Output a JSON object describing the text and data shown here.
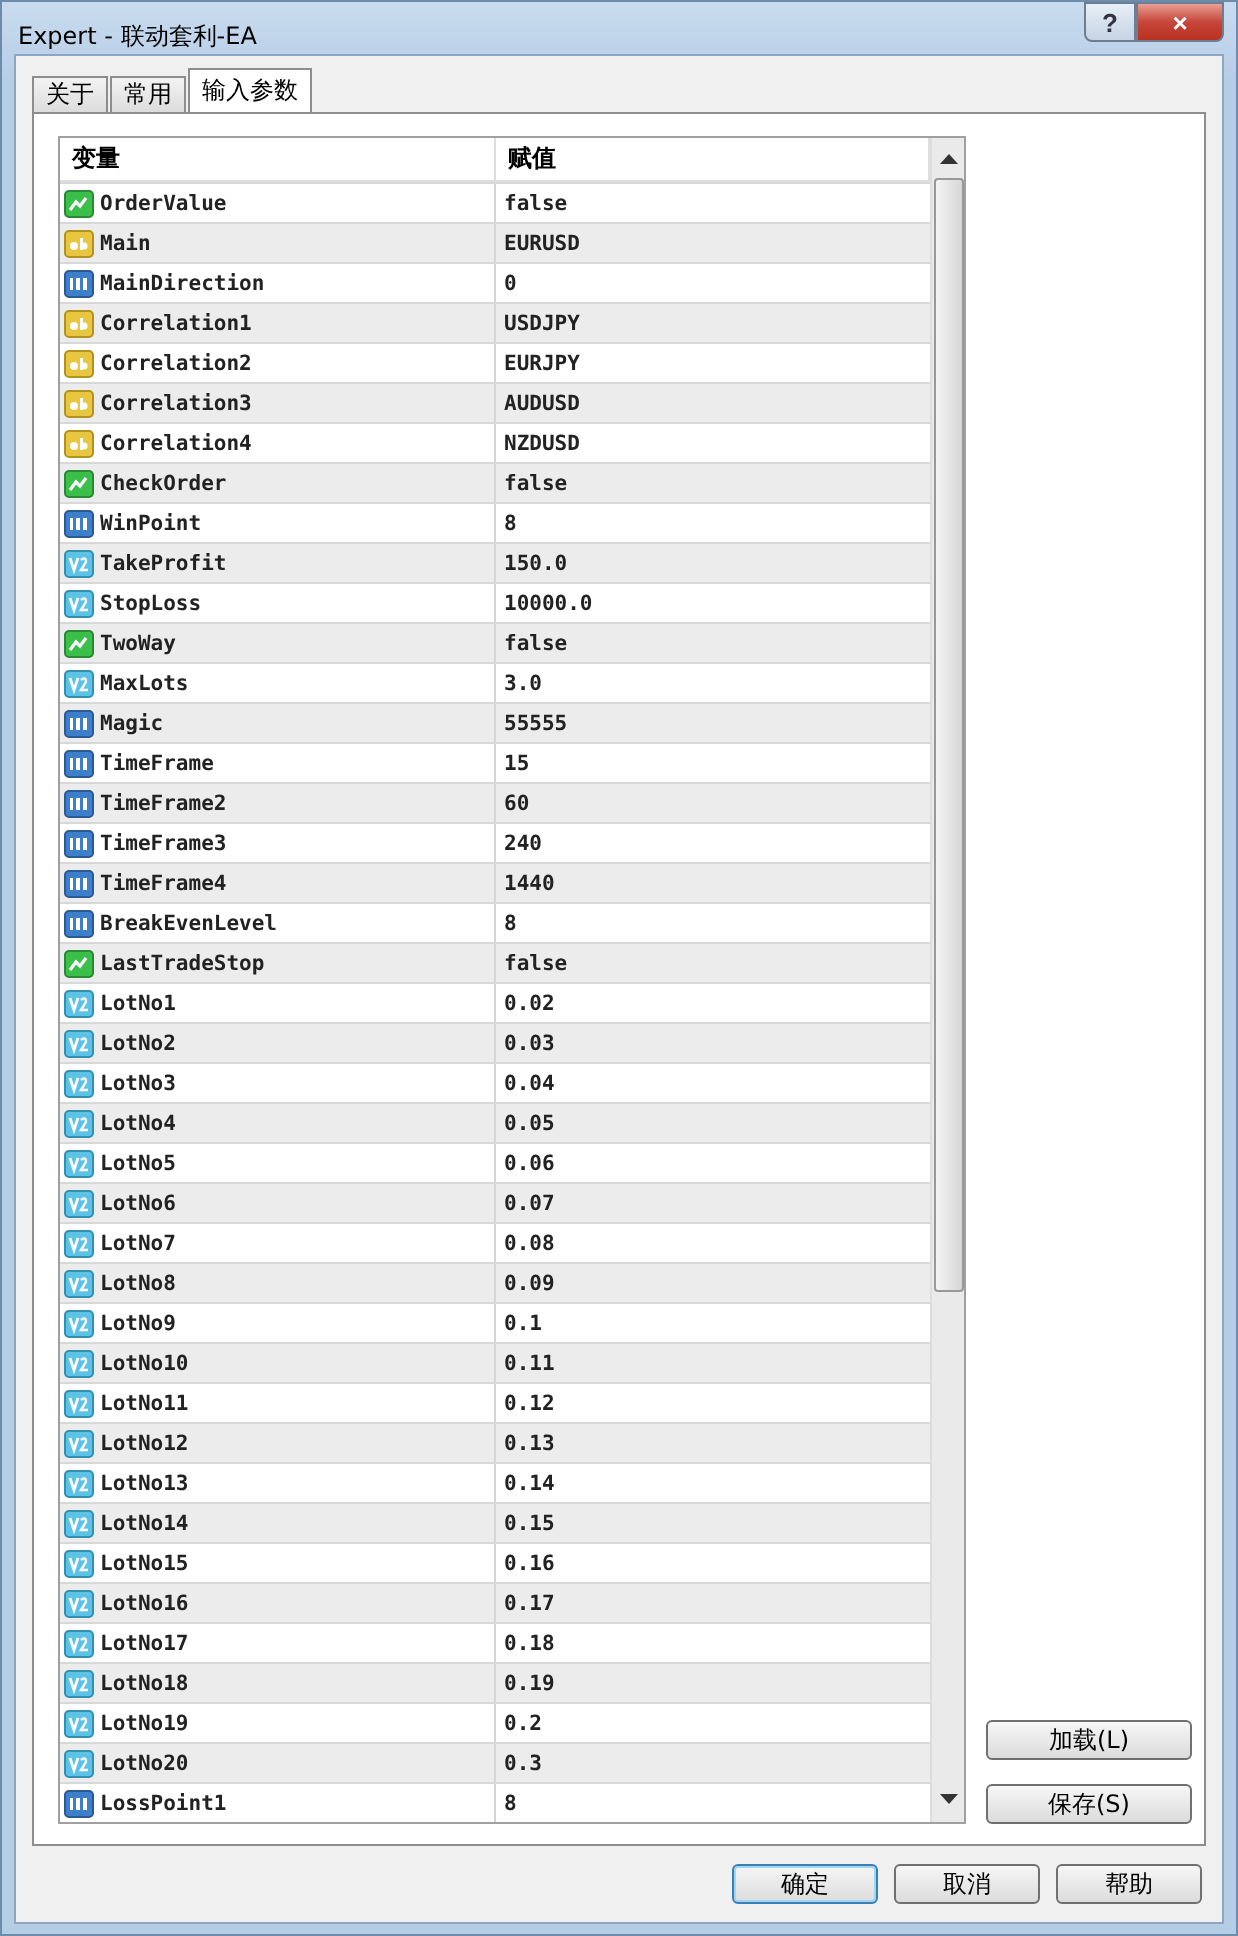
{
  "window": {
    "title": "Expert - 联动套利-EA",
    "help_button": "?",
    "close_button": "×"
  },
  "tabs": [
    {
      "label": "关于",
      "selected": false
    },
    {
      "label": "常用",
      "selected": false
    },
    {
      "label": "输入参数",
      "selected": true
    }
  ],
  "table": {
    "columns": [
      "变量",
      "赋值"
    ],
    "rows": [
      {
        "kind": "bool",
        "name": "OrderValue",
        "value": "false"
      },
      {
        "kind": "string",
        "name": "Main",
        "value": "EURUSD"
      },
      {
        "kind": "int",
        "name": "MainDirection",
        "value": "0"
      },
      {
        "kind": "string",
        "name": "Correlation1",
        "value": "USDJPY"
      },
      {
        "kind": "string",
        "name": "Correlation2",
        "value": "EURJPY"
      },
      {
        "kind": "string",
        "name": "Correlation3",
        "value": "AUDUSD"
      },
      {
        "kind": "string",
        "name": "Correlation4",
        "value": "NZDUSD"
      },
      {
        "kind": "bool",
        "name": "CheckOrder",
        "value": "false"
      },
      {
        "kind": "int",
        "name": "WinPoint",
        "value": "8"
      },
      {
        "kind": "double",
        "name": "TakeProfit",
        "value": "150.0"
      },
      {
        "kind": "double",
        "name": "StopLoss",
        "value": "10000.0"
      },
      {
        "kind": "bool",
        "name": "TwoWay",
        "value": "false"
      },
      {
        "kind": "double",
        "name": "MaxLots",
        "value": "3.0"
      },
      {
        "kind": "int",
        "name": "Magic",
        "value": "55555"
      },
      {
        "kind": "int",
        "name": "TimeFrame",
        "value": "15"
      },
      {
        "kind": "int",
        "name": "TimeFrame2",
        "value": "60"
      },
      {
        "kind": "int",
        "name": "TimeFrame3",
        "value": "240"
      },
      {
        "kind": "int",
        "name": "TimeFrame4",
        "value": "1440"
      },
      {
        "kind": "int",
        "name": "BreakEvenLevel",
        "value": "8"
      },
      {
        "kind": "bool",
        "name": "LastTradeStop",
        "value": "false"
      },
      {
        "kind": "double",
        "name": "LotNo1",
        "value": "0.02"
      },
      {
        "kind": "double",
        "name": "LotNo2",
        "value": "0.03"
      },
      {
        "kind": "double",
        "name": "LotNo3",
        "value": "0.04"
      },
      {
        "kind": "double",
        "name": "LotNo4",
        "value": "0.05"
      },
      {
        "kind": "double",
        "name": "LotNo5",
        "value": "0.06"
      },
      {
        "kind": "double",
        "name": "LotNo6",
        "value": "0.07"
      },
      {
        "kind": "double",
        "name": "LotNo7",
        "value": "0.08"
      },
      {
        "kind": "double",
        "name": "LotNo8",
        "value": "0.09"
      },
      {
        "kind": "double",
        "name": "LotNo9",
        "value": "0.1"
      },
      {
        "kind": "double",
        "name": "LotNo10",
        "value": "0.11"
      },
      {
        "kind": "double",
        "name": "LotNo11",
        "value": "0.12"
      },
      {
        "kind": "double",
        "name": "LotNo12",
        "value": "0.13"
      },
      {
        "kind": "double",
        "name": "LotNo13",
        "value": "0.14"
      },
      {
        "kind": "double",
        "name": "LotNo14",
        "value": "0.15"
      },
      {
        "kind": "double",
        "name": "LotNo15",
        "value": "0.16"
      },
      {
        "kind": "double",
        "name": "LotNo16",
        "value": "0.17"
      },
      {
        "kind": "double",
        "name": "LotNo17",
        "value": "0.18"
      },
      {
        "kind": "double",
        "name": "LotNo18",
        "value": "0.19"
      },
      {
        "kind": "double",
        "name": "LotNo19",
        "value": "0.2"
      },
      {
        "kind": "double",
        "name": "LotNo20",
        "value": "0.3"
      },
      {
        "kind": "int",
        "name": "LossPoint1",
        "value": "8"
      }
    ]
  },
  "side_buttons": [
    "加载(L)",
    "保存(S)"
  ],
  "buttons": [
    {
      "label": "确定",
      "default": true
    },
    {
      "label": "取消",
      "default": false
    },
    {
      "label": "帮助",
      "default": false
    }
  ]
}
